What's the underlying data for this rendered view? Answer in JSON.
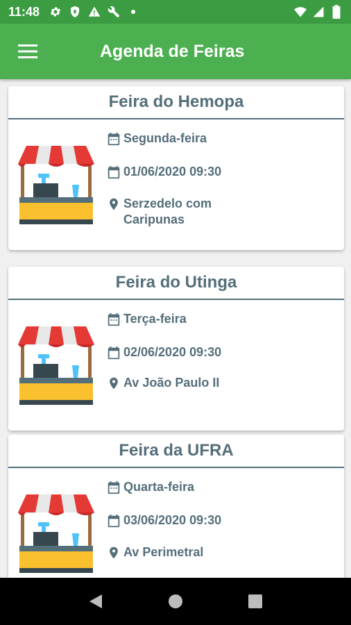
{
  "status_bar": {
    "time": "11:48",
    "left_icons": [
      "gear-icon",
      "shield-icon",
      "alert-icon",
      "wrench-icon",
      "dot-icon"
    ],
    "right_icons": [
      "wifi-icon",
      "signal-icon",
      "battery-icon"
    ]
  },
  "app_bar": {
    "title": "Agenda de Feiras",
    "menu_icon": "hamburger-menu-icon"
  },
  "colors": {
    "status_bar": "#3b9c42",
    "app_bar": "#4caf50",
    "text": "#546e7a"
  },
  "cards": [
    {
      "title": "Feira do Hemopa",
      "day": "Segunda-feira",
      "datetime": "01/06/2020 09:30",
      "location": "Serzedelo com Caripunas"
    },
    {
      "title": "Feira do Utinga",
      "day": "Terça-feira",
      "datetime": "02/06/2020 09:30",
      "location": "Av João Paulo II"
    },
    {
      "title": "Feira da UFRA",
      "day": "Quarta-feira",
      "datetime": "03/06/2020 09:30",
      "location": "Av Perimetral"
    }
  ],
  "nav_bar": {
    "buttons": [
      "back-icon",
      "home-icon",
      "recents-icon"
    ]
  }
}
